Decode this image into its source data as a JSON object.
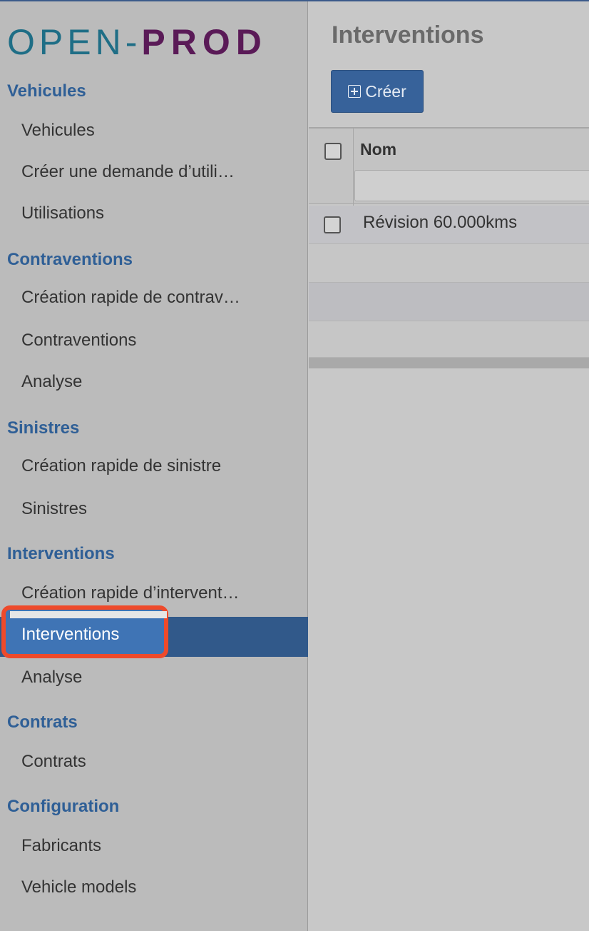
{
  "brand": {
    "part1": "OPEN-",
    "part2": "PROD"
  },
  "colors": {
    "section_title": "#2f5f96",
    "active_bg": "#31598a",
    "highlight_border": "#ee4a2b",
    "primary_button": "#37629a"
  },
  "sidebar": {
    "sections": [
      {
        "title": "Vehicules",
        "items": [
          "Vehicules",
          "Créer une demande d’utili…",
          "Utilisations"
        ]
      },
      {
        "title": "Contraventions",
        "items": [
          "Création rapide de contrav…",
          "Contraventions",
          "Analyse"
        ]
      },
      {
        "title": "Sinistres",
        "items": [
          "Création rapide de sinistre",
          "Sinistres"
        ]
      },
      {
        "title": "Interventions",
        "items": [
          "Création rapide d’intervent…",
          "Interventions",
          "Analyse"
        ]
      },
      {
        "title": "Contrats",
        "items": [
          "Contrats"
        ]
      },
      {
        "title": "Configuration",
        "items": [
          "Fabricants",
          "Vehicle models"
        ]
      }
    ]
  },
  "main": {
    "title": "Interventions",
    "create_label": "Créer",
    "table": {
      "columns": [
        "Nom"
      ],
      "filter_value": "",
      "rows": [
        [
          "Révision 60.000kms"
        ],
        [
          ""
        ],
        [
          ""
        ],
        [
          ""
        ]
      ]
    }
  }
}
